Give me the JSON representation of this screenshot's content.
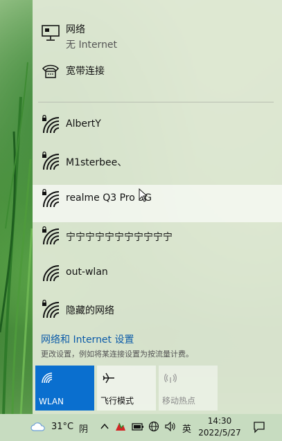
{
  "flyout": {
    "network": {
      "title": "网络",
      "status": "无 Internet"
    },
    "broadband": {
      "label": "宽带连接"
    },
    "wifi_list": [
      {
        "ssid": "AlbertY",
        "secured": true
      },
      {
        "ssid": "M1sterbee、",
        "secured": true
      },
      {
        "ssid": "realme Q3 Pro 5G",
        "secured": true,
        "hovered": true
      },
      {
        "ssid": "宁宁宁宁宁宁宁宁宁宁宁",
        "secured": true
      },
      {
        "ssid": "out-wlan",
        "secured": false
      },
      {
        "ssid": "隐藏的网络",
        "secured": true
      }
    ],
    "settings": {
      "link": "网络和 Internet 设置",
      "description": "更改设置，例如将某连接设置为按流量计费。"
    },
    "quick_actions": [
      {
        "label": "WLAN",
        "state": "on",
        "icon": "wifi-icon"
      },
      {
        "label": "飞行模式",
        "state": "off",
        "icon": "airplane-icon"
      },
      {
        "label": "移动热点",
        "state": "disabled",
        "icon": "hotspot-icon"
      }
    ]
  },
  "taskbar": {
    "weather_temp": "31°C",
    "weather_desc": "阴",
    "ime": "英",
    "time": "14:30",
    "date": "2022/5/27"
  },
  "colors": {
    "accent": "#0a6fcf",
    "link": "#0a5aa8",
    "panel": "#e2e9d7"
  }
}
